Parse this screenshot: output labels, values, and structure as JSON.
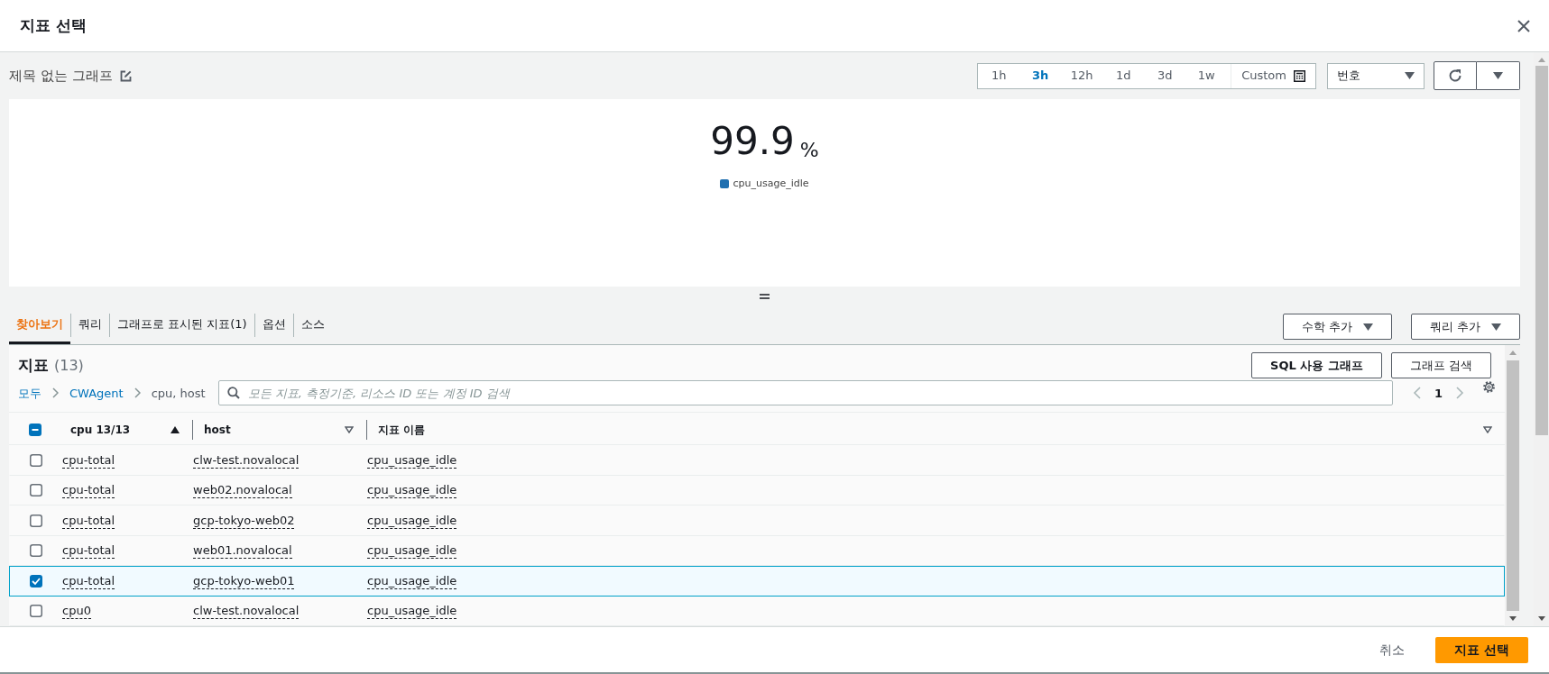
{
  "dialog": {
    "title": "지표 선택"
  },
  "graph": {
    "title": "제목 없는 그래프",
    "time_ranges": [
      {
        "label": "1h",
        "selected": false
      },
      {
        "label": "3h",
        "selected": true
      },
      {
        "label": "12h",
        "selected": false
      },
      {
        "label": "1d",
        "selected": false
      },
      {
        "label": "3d",
        "selected": false
      },
      {
        "label": "1w",
        "selected": false
      }
    ],
    "custom": "Custom",
    "view_select": "번호",
    "value": "99.9",
    "unit": "%",
    "legend": [
      {
        "label": "cpu_usage_idle",
        "color": "#1f6fb0"
      }
    ]
  },
  "tabs": [
    {
      "label": "찾아보기",
      "selected": true
    },
    {
      "label": "쿼리",
      "selected": false
    },
    {
      "label": "그래프로 표시된 지표(1)",
      "selected": false
    },
    {
      "label": "옵션",
      "selected": false
    },
    {
      "label": "소스",
      "selected": false
    }
  ],
  "tab_actions": [
    "수학 추가",
    "쿼리 추가"
  ],
  "metrics": {
    "title": "지표",
    "count": "(13)",
    "actions": [
      "SQL 사용 그래프",
      "그래프 검색"
    ],
    "breadcrumb": [
      {
        "label": "모두",
        "link": true
      },
      {
        "label": "CWAgent",
        "link": true
      },
      {
        "label": "cpu, host",
        "link": false
      }
    ],
    "search": {
      "placeholder": "모든 지표, 측정기준, 리소스 ID 또는 계정 ID 검색"
    },
    "page": "1",
    "select_all": {
      "checked": true,
      "indeterminate": true
    },
    "columns": [
      {
        "label": "cpu 13/13",
        "sorted": true,
        "descending": false
      },
      {
        "label": "host",
        "sorted": false
      },
      {
        "label": "지표 이름",
        "sorted": false
      }
    ],
    "rows": [
      {
        "cells": [
          "cpu-total",
          "clw-test.novalocal",
          "cpu_usage_idle"
        ],
        "selected": false
      },
      {
        "cells": [
          "cpu-total",
          "web02.novalocal",
          "cpu_usage_idle"
        ],
        "selected": false
      },
      {
        "cells": [
          "cpu-total",
          "gcp-tokyo-web02",
          "cpu_usage_idle"
        ],
        "selected": false
      },
      {
        "cells": [
          "cpu-total",
          "web01.novalocal",
          "cpu_usage_idle"
        ],
        "selected": false
      },
      {
        "cells": [
          "cpu-total",
          "gcp-tokyo-web01",
          "cpu_usage_idle"
        ],
        "selected": true
      },
      {
        "cells": [
          "cpu0",
          "clw-test.novalocal",
          "cpu_usage_idle"
        ],
        "selected": false
      }
    ]
  },
  "footer": {
    "cancel": "취소",
    "confirm": "지표 선택"
  }
}
